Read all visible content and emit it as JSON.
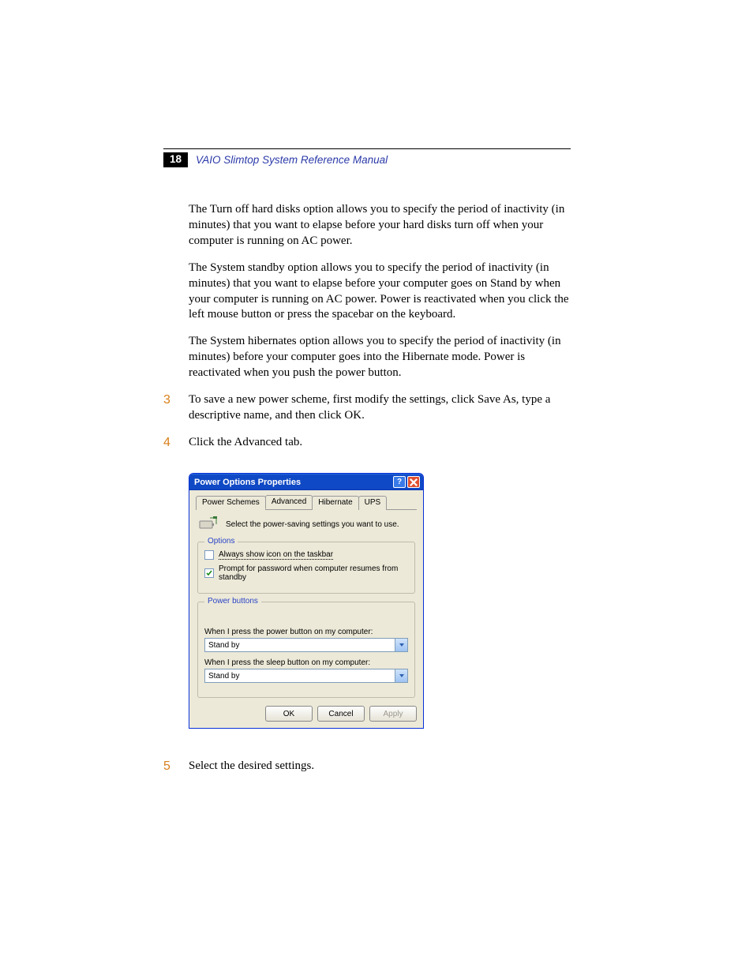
{
  "header": {
    "page_number": "18",
    "manual_title": "VAIO Slimtop System Reference Manual"
  },
  "paragraphs": {
    "p1": "The Turn off hard disks option allows you to specify the period of inactivity (in minutes) that you want to elapse before your hard disks turn off when your computer is running on AC power.",
    "p2": "The System standby option allows you to specify the period of inactivity (in minutes) that you want to elapse before your computer goes on Stand by when your computer is running on AC power. Power is reactivated when you click the left mouse button or press the spacebar on the keyboard.",
    "p3": "The System hibernates option allows you to specify the period of inactivity (in minutes) before your computer goes into the Hibernate mode. Power is reactivated when you push the power button."
  },
  "steps": {
    "s3_num": "3",
    "s3_text": "To save a new power scheme, first modify the settings, click Save As, type a descriptive name, and then click OK.",
    "s4_num": "4",
    "s4_text": "Click the Advanced tab.",
    "s5_num": "5",
    "s5_text": "Select the desired settings."
  },
  "dialog": {
    "title": "Power Options Properties",
    "tabs": {
      "t1": "Power Schemes",
      "t2": "Advanced",
      "t3": "Hibernate",
      "t4": "UPS"
    },
    "intro": "Select the power-saving settings you want to use.",
    "options_group": "Options",
    "opt_show_icon": "Always show icon on the taskbar",
    "opt_prompt_pw": "Prompt for password when computer resumes from standby",
    "pb_group": "Power buttons",
    "pb_label1": "When I press the power button on my computer:",
    "pb_value1": "Stand by",
    "pb_label2": "When I press the sleep button on my computer:",
    "pb_value2": "Stand by",
    "buttons": {
      "ok": "OK",
      "cancel": "Cancel",
      "apply": "Apply"
    }
  }
}
